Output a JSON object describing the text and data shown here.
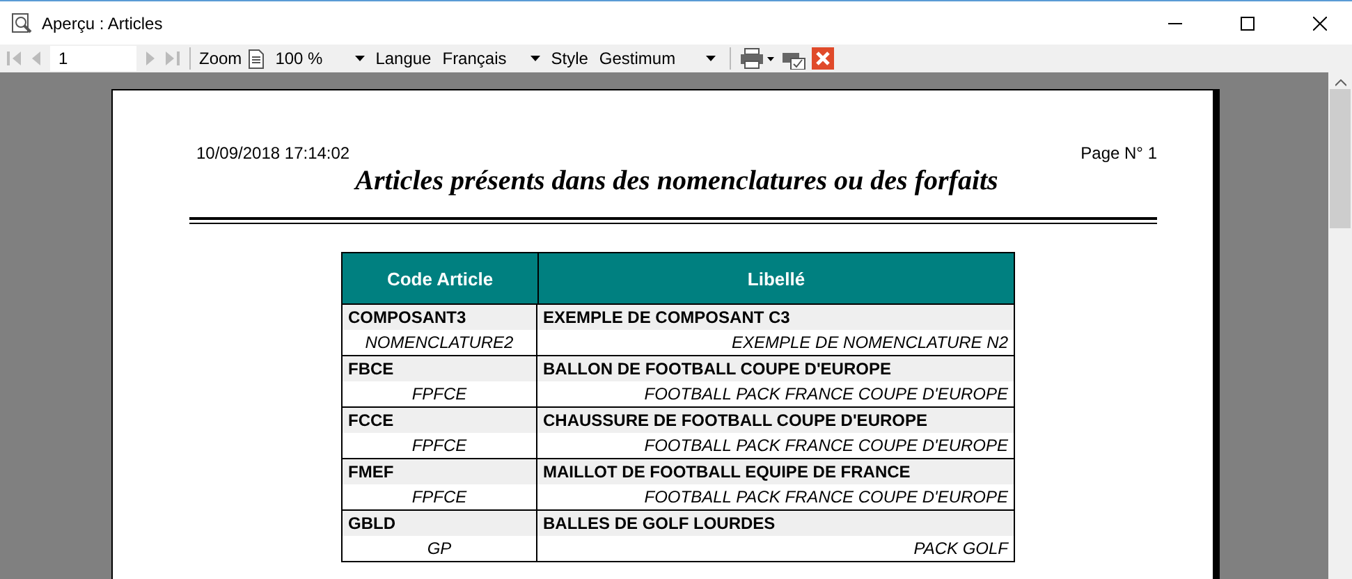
{
  "window": {
    "title": "Aperçu : Articles"
  },
  "toolbar": {
    "page": "1",
    "zoom_label": "Zoom",
    "zoom": "100 %",
    "language_label": "Langue",
    "language": "Français",
    "style_label": "Style",
    "style": "Gestimum"
  },
  "report": {
    "date": "10/09/2018 17:14:02",
    "page": "Page N° 1",
    "title": "Articles présents dans des nomenclatures ou des forfaits",
    "columns": [
      "Code Article",
      "Libellé"
    ],
    "rows": [
      {
        "code": "COMPOSANT3",
        "label": "EXEMPLE DE COMPOSANT C3",
        "parent_code": "NOMENCLATURE2",
        "parent_label": "EXEMPLE DE NOMENCLATURE N2"
      },
      {
        "code": "FBCE",
        "label": "BALLON DE FOOTBALL COUPE D'EUROPE",
        "parent_code": "FPFCE",
        "parent_label": "FOOTBALL PACK FRANCE COUPE D'EUROPE"
      },
      {
        "code": "FCCE",
        "label": "CHAUSSURE DE FOOTBALL COUPE D'EUROPE",
        "parent_code": "FPFCE",
        "parent_label": "FOOTBALL PACK FRANCE COUPE D'EUROPE"
      },
      {
        "code": "FMEF",
        "label": "MAILLOT DE FOOTBALL EQUIPE DE FRANCE",
        "parent_code": "FPFCE",
        "parent_label": "FOOTBALL PACK FRANCE COUPE D'EUROPE"
      },
      {
        "code": "GBLD",
        "label": "BALLES DE GOLF LOURDES",
        "parent_code": "GP",
        "parent_label": "PACK GOLF"
      }
    ]
  }
}
